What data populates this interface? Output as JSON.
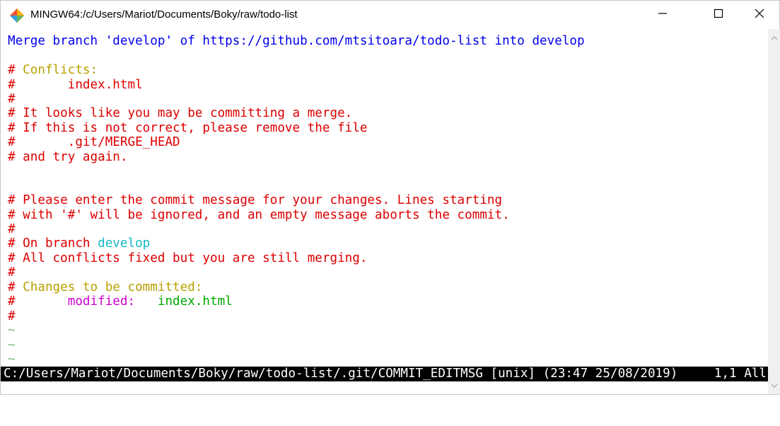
{
  "window": {
    "title": "MINGW64:/c/Users/Mariot/Documents/Boky/raw/todo-list",
    "icon": "git-diamond-icon",
    "controls": [
      "minimize-icon",
      "maximize-icon",
      "close-icon"
    ]
  },
  "editor": {
    "merge_header": "Merge branch 'develop' of https://github.com/mtsitoara/todo-list into develop",
    "hash": "#",
    "conflicts_label": " Conflicts:",
    "conflict_file": "       index.html",
    "merge_msg_1": " It looks like you may be committing a merge.",
    "merge_msg_2": " If this is not correct, please remove the file",
    "merge_msg_3": "       .git/MERGE_HEAD",
    "merge_msg_4": " and try again.",
    "please_1": " Please enter the commit message for your changes. Lines starting",
    "please_2": " with '#' will be ignored, and an empty message aborts the commit.",
    "branch_prefix": " On branch ",
    "branch_name": "develop",
    "all_fixed": " All conflicts fixed but you are still merging.",
    "changes_label": " Changes to be committed:",
    "modified_label": "       modified:",
    "modified_file": "   index.html",
    "tilde": "~"
  },
  "status": {
    "file_info": "C:/Users/Mariot/Documents/Boky/raw/todo-list/.git/COMMIT_EDITMSG [unix] (23:47 25/08/2019)",
    "position": "1,1 All"
  },
  "colors": {
    "header": "#0000ee",
    "comment": "#dd0000",
    "section": "#b8a000",
    "branch": "#14b8c8",
    "modified": "#cc00cc",
    "filename": "#00a800",
    "tilde": "#7ab87a"
  }
}
